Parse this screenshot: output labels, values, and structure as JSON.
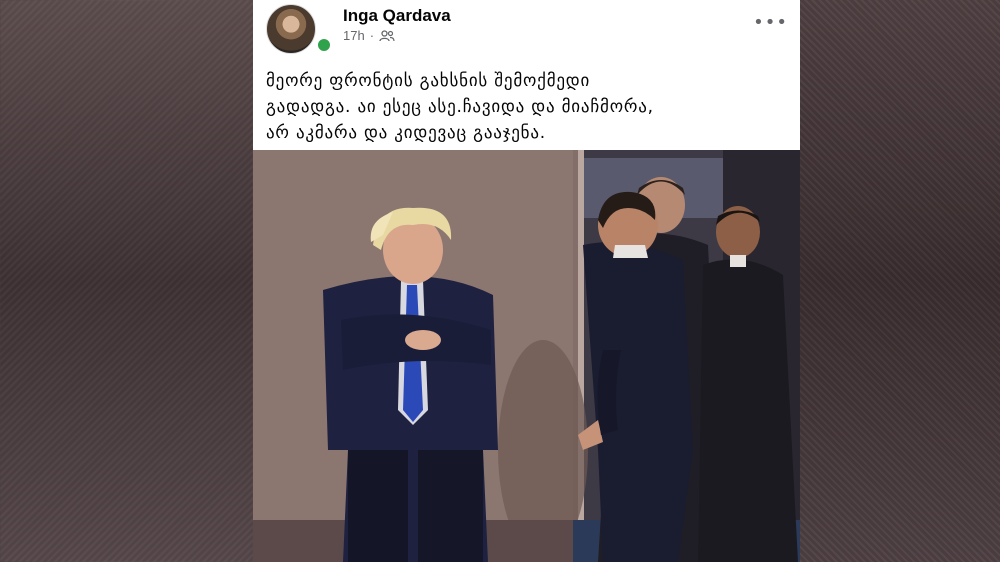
{
  "post": {
    "author": "Inga Qardava",
    "time": "17h",
    "separator": "·",
    "audience_icon": "friends-icon",
    "more_icon": "more-options-icon",
    "text_lines": [
      "მეორე ფრონტის გახსნის შემოქმედი",
      "გადადგა. აი ესეც ასე.ჩავიდა და მიაჩმორა,",
      "არ აკმარა და კიდევაც გააჯენა."
    ],
    "more_glyph": "•••"
  },
  "colors": {
    "status_online": "#31a24c",
    "text_primary": "#050505",
    "text_secondary": "#65676b"
  }
}
